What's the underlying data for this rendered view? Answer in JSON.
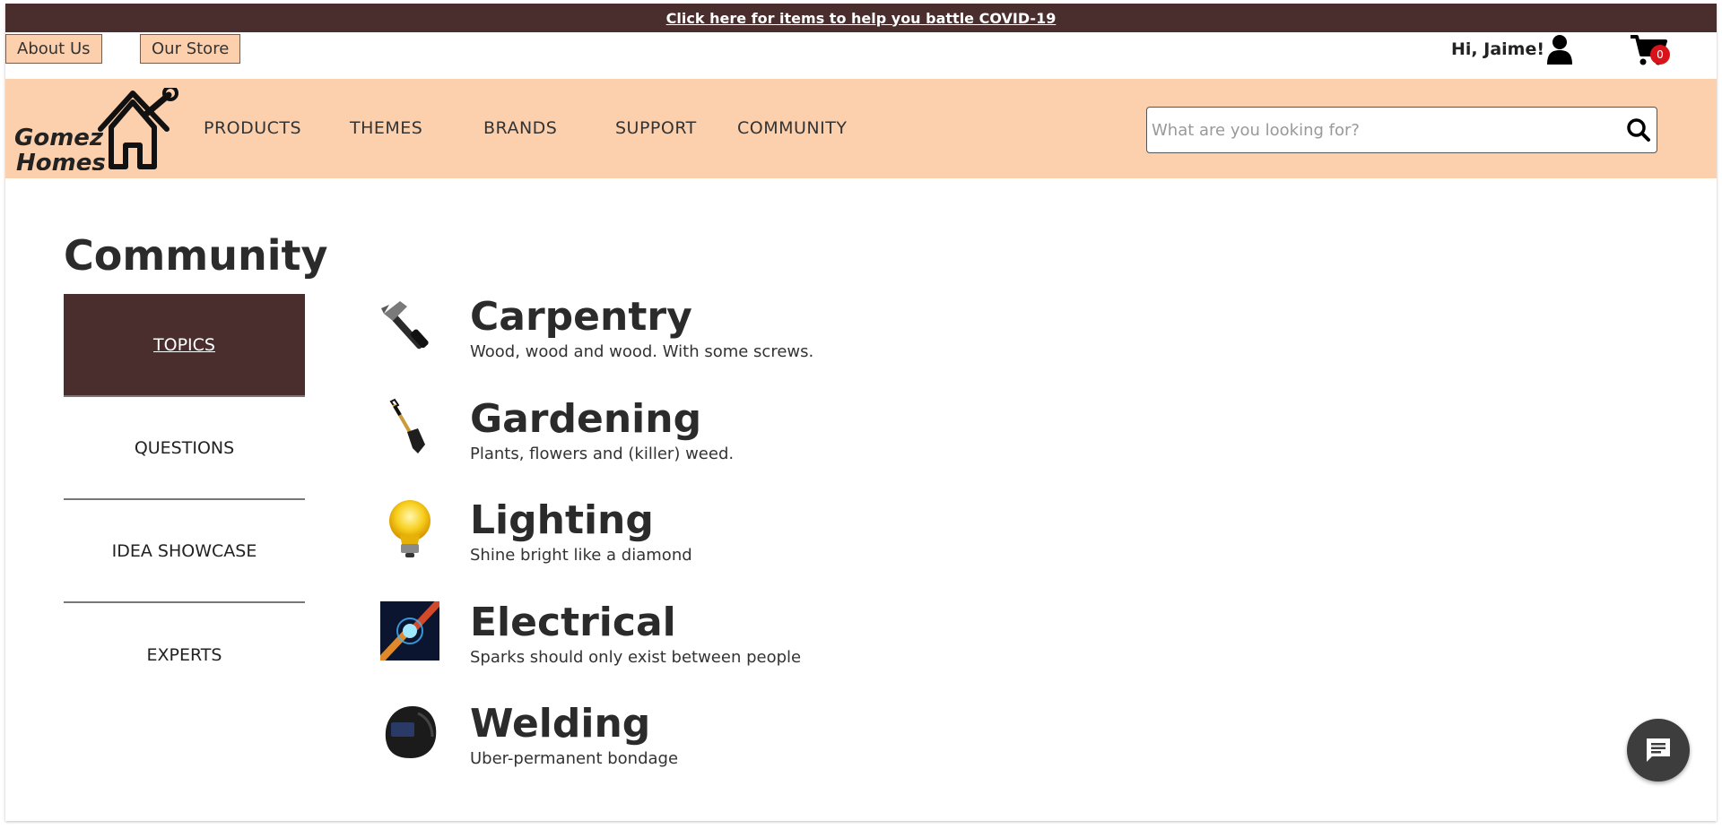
{
  "promo": {
    "text": "Click here for items to help you battle COVID-19"
  },
  "utility": {
    "about_label": "About Us",
    "store_label": "Our Store",
    "greeting": "Hi, Jaime!",
    "cart_count": "0"
  },
  "logo": {
    "line1": "Gomez",
    "line2": "Homes"
  },
  "nav": {
    "items": [
      {
        "label": "PRODUCTS"
      },
      {
        "label": "THEMES"
      },
      {
        "label": "BRANDS"
      },
      {
        "label": "SUPPORT"
      },
      {
        "label": "COMMUNITY"
      }
    ]
  },
  "search": {
    "placeholder": "What are you looking for?",
    "value": ""
  },
  "page": {
    "title": "Community"
  },
  "sidebar": {
    "items": [
      {
        "label": "TOPICS",
        "active": true
      },
      {
        "label": "QUESTIONS",
        "active": false
      },
      {
        "label": "IDEA SHOWCASE",
        "active": false
      },
      {
        "label": "EXPERTS",
        "active": false
      }
    ]
  },
  "topics": [
    {
      "title": "Carpentry",
      "description": "Wood, wood and wood. With some screws.",
      "icon": "hammer-icon"
    },
    {
      "title": "Gardening",
      "description": "Plants, flowers and (killer) weed.",
      "icon": "shovel-icon"
    },
    {
      "title": "Lighting",
      "description": "Shine bright like a diamond",
      "icon": "lightbulb-icon"
    },
    {
      "title": "Electrical",
      "description": "Sparks should only exist between people",
      "icon": "spark-icon"
    },
    {
      "title": "Welding",
      "description": "Uber-permanent bondage",
      "icon": "welding-helmet-icon"
    }
  ],
  "colors": {
    "brand_dark": "#4a2d2d",
    "brand_peach": "#fdd0ad",
    "badge_red": "#d8141a"
  }
}
